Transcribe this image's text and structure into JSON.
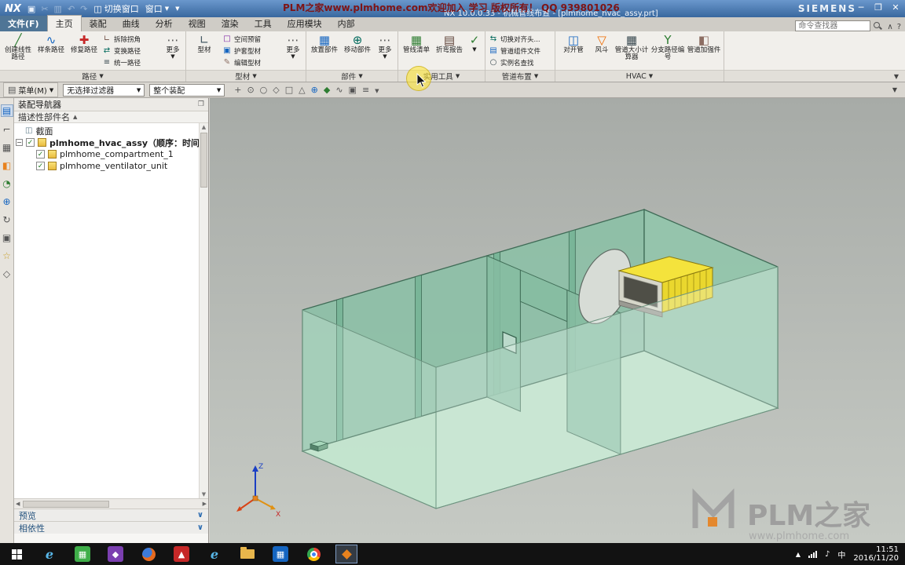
{
  "titlebar": {
    "logo": "NX",
    "watermark": "PLM之家www.plmhome.com欢迎加入 学习 版权所有！ QQ 939801026",
    "window_title": "NX 10.0.0.33 - 机械管线布置 - [plmhome_hvac_assy.prt]",
    "switch_window": "切换窗口",
    "window_menu": "窗口",
    "brand": "SIEMENS"
  },
  "tabs": {
    "file": "文件(F)",
    "home": "主页",
    "assembly": "装配",
    "curve": "曲线",
    "analysis": "分析",
    "view": "视图",
    "render": "渲染",
    "tools": "工具",
    "app_modules": "应用模块",
    "internal": "内部",
    "finder_placeholder": "命令查找器"
  },
  "ribbon": {
    "path": {
      "label": "路径",
      "b1": "创建线性路径",
      "b2": "样条路径",
      "b3": "修复路径",
      "s1": "拆除拐角",
      "s2": "变换路径",
      "s3": "统一路径",
      "more": "更多"
    },
    "profile": {
      "label": "型材",
      "b1": "型材",
      "s1": "空间预留",
      "s2": "护套型材",
      "s3": "编辑型材",
      "more": "更多"
    },
    "part": {
      "label": "部件",
      "b1": "放置部件",
      "b2": "移动部件",
      "more": "更多"
    },
    "utility": {
      "label": "实用工具",
      "b1": "管线清单",
      "b2": "折弯报告"
    },
    "pipe": {
      "label": "管道布置",
      "s1": "切换对齐头...",
      "s2": "管道组件文件",
      "s3": "实例名查找"
    },
    "hvac": {
      "label": "HVAC",
      "b1": "对开管",
      "b2": "风斗",
      "b3": "管道大小计算器",
      "b4": "分支路径编号",
      "b5": "管道加强件"
    }
  },
  "toolbar": {
    "menu": "菜单(M)",
    "selection_filter": "无选择过滤器",
    "scope": "整个装配"
  },
  "navigator": {
    "title": "装配导航器",
    "column": "描述性部件名",
    "sections": "截面",
    "assembly": "plmhome_hvac_assy（顺序：时间顺序）",
    "comp1": "plmhome_compartment_1",
    "comp2": "plmhome_ventilator_unit",
    "preview": "预览",
    "dependencies": "相依性"
  },
  "viewport": {
    "triad_x": "X",
    "triad_z": "Z",
    "watermark_name": "PLM之家",
    "watermark_url": "www.plmhome.com"
  },
  "taskbar": {
    "time": "11:51",
    "date": "2016/11/20",
    "ime": "中"
  },
  "colors": {
    "hvac_unit": "#f4e33c",
    "wall": "#8cc0a6",
    "floor": "#b7dfc6",
    "highlight": "#ffe628",
    "titlebar": "#39689f",
    "watermark_red": "#7e1416"
  }
}
